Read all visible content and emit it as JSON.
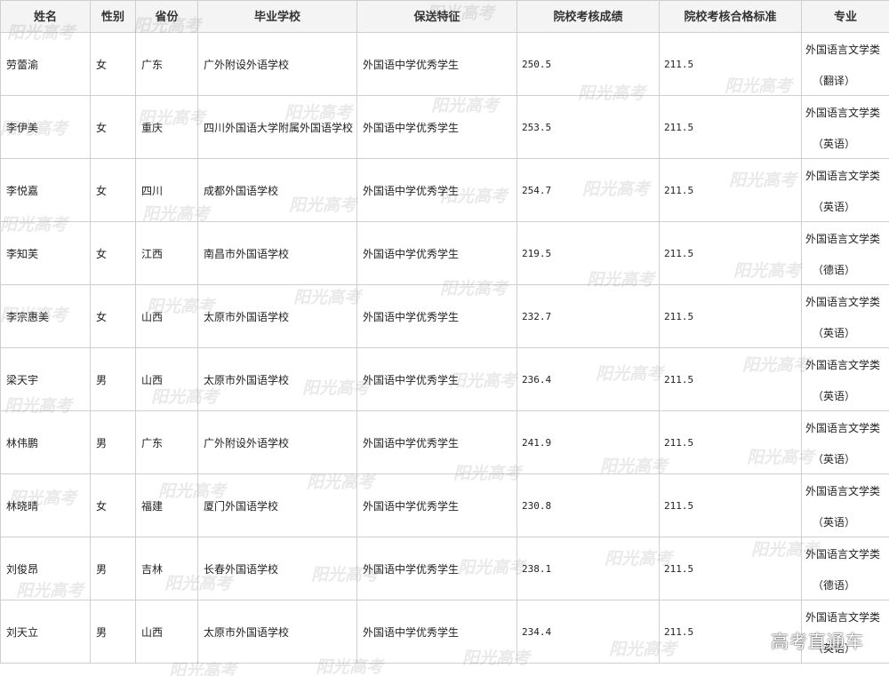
{
  "headers": [
    "姓名",
    "性别",
    "省份",
    "毕业学校",
    "保送特征",
    "院校考核成绩",
    "院校考核合格标准",
    "专业"
  ],
  "rows": [
    {
      "name": "劳蕾渝",
      "gender": "女",
      "province": "广东",
      "school": "广外附设外语学校",
      "feature": "外国语中学优秀学生",
      "score": "250.5",
      "standard": "211.5",
      "major_line1": "外国语言文学类",
      "major_line2": "（翻译）"
    },
    {
      "name": "李伊美",
      "gender": "女",
      "province": "重庆",
      "school": "四川外国语大学附属外国语学校",
      "feature": "外国语中学优秀学生",
      "score": "253.5",
      "standard": "211.5",
      "major_line1": "外国语言文学类",
      "major_line2": "（英语）"
    },
    {
      "name": "李悦嘉",
      "gender": "女",
      "province": "四川",
      "school": "成都外国语学校",
      "feature": "外国语中学优秀学生",
      "score": "254.7",
      "standard": "211.5",
      "major_line1": "外国语言文学类",
      "major_line2": "（英语）"
    },
    {
      "name": "李知芙",
      "gender": "女",
      "province": "江西",
      "school": "南昌市外国语学校",
      "feature": "外国语中学优秀学生",
      "score": "219.5",
      "standard": "211.5",
      "major_line1": "外国语言文学类",
      "major_line2": "（德语）"
    },
    {
      "name": "李宗惠美",
      "gender": "女",
      "province": "山西",
      "school": "太原市外国语学校",
      "feature": "外国语中学优秀学生",
      "score": "232.7",
      "standard": "211.5",
      "major_line1": "外国语言文学类",
      "major_line2": "（英语）"
    },
    {
      "name": "梁天宇",
      "gender": "男",
      "province": "山西",
      "school": "太原市外国语学校",
      "feature": "外国语中学优秀学生",
      "score": "236.4",
      "standard": "211.5",
      "major_line1": "外国语言文学类",
      "major_line2": "（英语）"
    },
    {
      "name": "林伟鹏",
      "gender": "男",
      "province": "广东",
      "school": "广外附设外语学校",
      "feature": "外国语中学优秀学生",
      "score": "241.9",
      "standard": "211.5",
      "major_line1": "外国语言文学类",
      "major_line2": "（英语）"
    },
    {
      "name": "林晓晴",
      "gender": "女",
      "province": "福建",
      "school": "厦门外国语学校",
      "feature": "外国语中学优秀学生",
      "score": "230.8",
      "standard": "211.5",
      "major_line1": "外国语言文学类",
      "major_line2": "（英语）"
    },
    {
      "name": "刘俊昂",
      "gender": "男",
      "province": "吉林",
      "school": "长春外国语学校",
      "feature": "外国语中学优秀学生",
      "score": "238.1",
      "standard": "211.5",
      "major_line1": "外国语言文学类",
      "major_line2": "（德语）"
    },
    {
      "name": "刘天立",
      "gender": "男",
      "province": "山西",
      "school": "太原市外国语学校",
      "feature": "外国语中学优秀学生",
      "score": "234.4",
      "standard": "211.5",
      "major_line1": "外国语言文学类",
      "major_line2": "（英语）"
    }
  ],
  "watermark_text": "阳光高考",
  "corner_watermark": "高考直通车",
  "colors": {
    "border": "#cfcfcf",
    "header_bg": "#f4f4f4",
    "text": "#222222"
  }
}
